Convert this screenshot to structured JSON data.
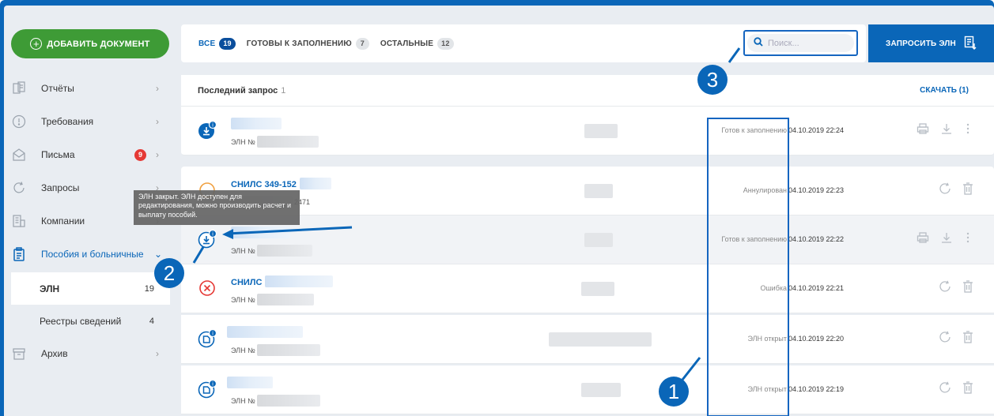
{
  "sidebar": {
    "add_document": "ДОБАВИТЬ ДОКУМЕНТ",
    "items": [
      {
        "label": "Отчёты",
        "icon": "reports-icon"
      },
      {
        "label": "Требования",
        "icon": "alert-circle-icon"
      },
      {
        "label": "Письма",
        "icon": "mail-icon",
        "badge": "9"
      },
      {
        "label": "Запросы",
        "icon": "refresh-icon"
      },
      {
        "label": "Компании",
        "icon": "building-icon"
      },
      {
        "label": "Пособия и больничные",
        "icon": "clipboard-icon"
      },
      {
        "label": "Архив",
        "icon": "archive-icon"
      }
    ],
    "sub": [
      {
        "label": "ЭЛН",
        "count": "19"
      },
      {
        "label": "Реестры сведений",
        "count": "4"
      }
    ]
  },
  "tabs": [
    {
      "label": "ВСЕ",
      "count": "19"
    },
    {
      "label": "ГОТОВЫ К ЗАПОЛНЕНИЮ",
      "count": "7"
    },
    {
      "label": "ОСТАЛЬНЫЕ",
      "count": "12"
    }
  ],
  "search": {
    "placeholder": "Поиск..."
  },
  "request_button": "ЗАПРОСИТЬ ЭЛН",
  "header": {
    "title": "Последний запрос",
    "count": "1",
    "download": "СКАЧАТЬ (1)"
  },
  "rows": [
    {
      "name": "",
      "eln": "ЭЛН №",
      "status": "Готов к заполнению",
      "date": "04.10.2019 22:24"
    },
    {
      "name": "СНИЛС 349-152",
      "eln": "2471",
      "status": "Аннулирован",
      "date": "04.10.2019 22:23"
    },
    {
      "name": "",
      "eln": "ЭЛН №",
      "status": "Готов к заполнению",
      "date": "04.10.2019 22:22"
    },
    {
      "name": "СНИЛС",
      "eln": "ЭЛН №",
      "status": "Ошибка",
      "date": "04.10.2019 22:21"
    },
    {
      "name": "",
      "eln": "ЭЛН №",
      "status": "ЭЛН открыт",
      "date": "04.10.2019 22:20"
    },
    {
      "name": "",
      "eln": "ЭЛН №",
      "status": "ЭЛН открыт",
      "date": "04.10.2019 22:19"
    }
  ],
  "tooltip": "ЭЛН закрыт. ЭЛН доступен для редактирования, можно производить расчет и выплату пособий.",
  "annotations": [
    "1",
    "2",
    "3"
  ],
  "colors": {
    "primary": "#0a66b8",
    "green": "#3e9b36",
    "red": "#e53935"
  }
}
